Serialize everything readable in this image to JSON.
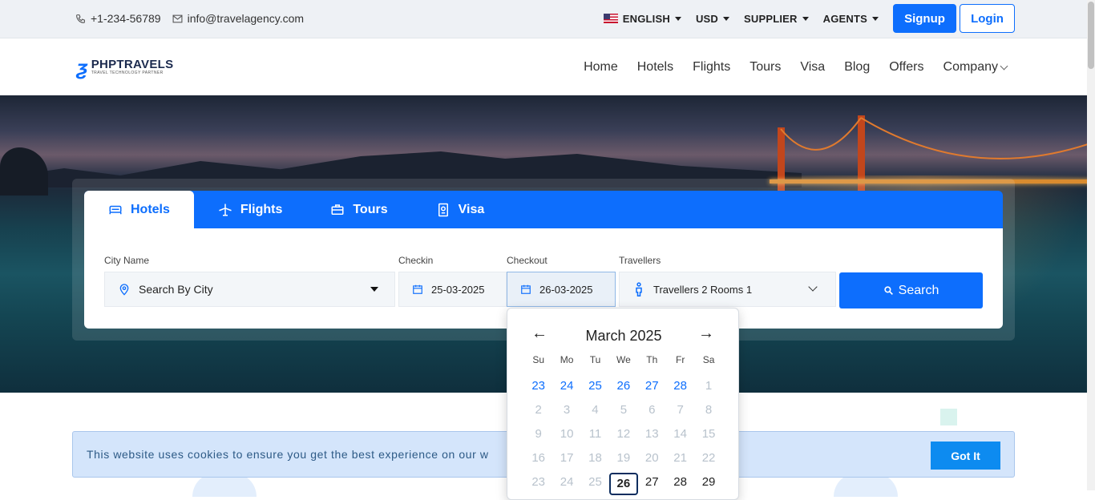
{
  "topbar": {
    "phone": "+1-234-56789",
    "email": "info@travelagency.com",
    "language": "ENGLISH",
    "currency": "USD",
    "supplier": "SUPPLIER",
    "agents": "AGENTS",
    "signup": "Signup",
    "login": "Login"
  },
  "brand": {
    "name": "PHPTRAVELS",
    "tagline": "TRAVEL TECHNOLOGY PARTNER"
  },
  "nav": {
    "items": [
      "Home",
      "Hotels",
      "Flights",
      "Tours",
      "Visa",
      "Blog",
      "Offers",
      "Company"
    ]
  },
  "search": {
    "tabs": [
      "Hotels",
      "Flights",
      "Tours",
      "Visa"
    ],
    "active_tab": "Hotels",
    "city_label": "City Name",
    "city_value": "Search By City",
    "checkin_label": "Checkin",
    "checkin_value": "25-03-2025",
    "checkout_label": "Checkout",
    "checkout_value": "26-03-2025",
    "travellers_label": "Travellers",
    "travellers_value": "Travellers 2 Rooms 1",
    "search_button": "Search"
  },
  "calendar": {
    "month": "March 2025",
    "weekdays": [
      "Su",
      "Mo",
      "Tu",
      "We",
      "Th",
      "Fr",
      "Sa"
    ],
    "rows": [
      [
        "23",
        "24",
        "25",
        "26",
        "27",
        "28",
        "1"
      ],
      [
        "2",
        "3",
        "4",
        "5",
        "6",
        "7",
        "8"
      ],
      [
        "9",
        "10",
        "11",
        "12",
        "13",
        "14",
        "15"
      ],
      [
        "16",
        "17",
        "18",
        "19",
        "20",
        "21",
        "22"
      ],
      [
        "23",
        "24",
        "25",
        "26",
        "27",
        "28",
        "29"
      ]
    ],
    "selected": "26"
  },
  "cookie": {
    "message": "This website uses cookies to ensure you get the best experience on our w",
    "button": "Got It"
  },
  "colors": {
    "primary": "#0d6efd",
    "cookie_bg": "#d4e5fb"
  }
}
